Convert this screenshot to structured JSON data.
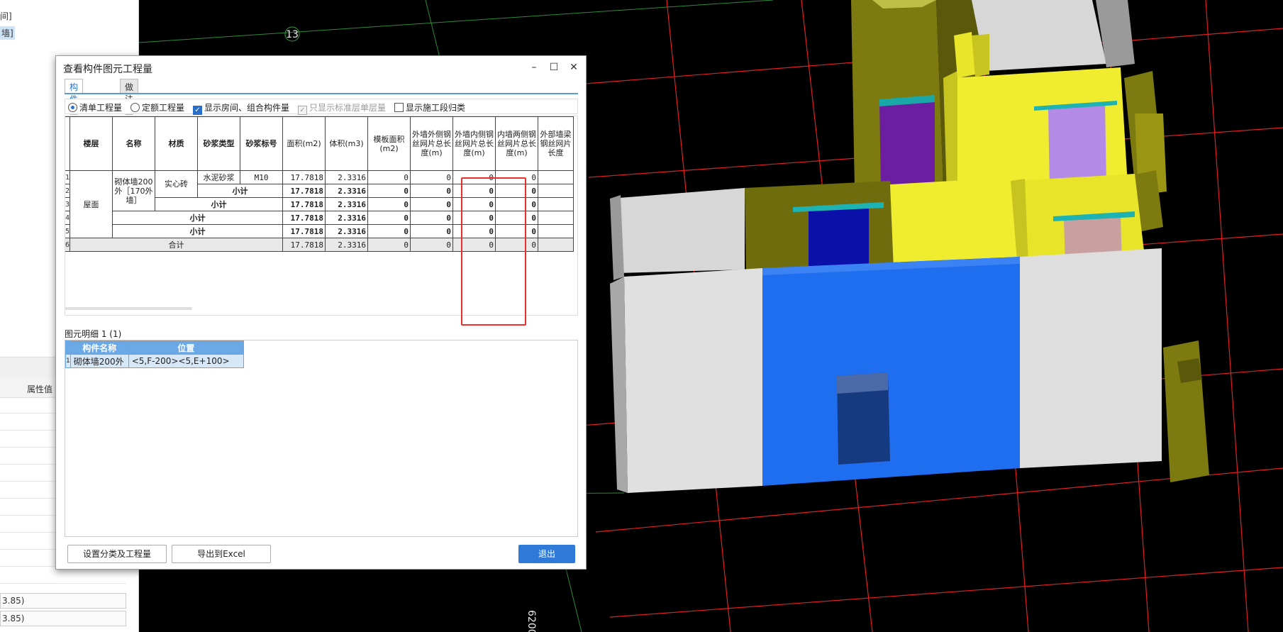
{
  "left_panel": {
    "tree_line_1": "间]",
    "tree_line_2": "墙]",
    "prop_header": "属性值",
    "bottom_values": [
      "3.85)",
      "3.85)"
    ]
  },
  "view3d": {
    "axis_label_top": "13",
    "axis_label_bottom": "6200"
  },
  "dialog": {
    "title": "查看构件图元工程量",
    "tabs": [
      "构件工程量",
      "做法工程量"
    ],
    "options": [
      {
        "label": "清单工程量",
        "type": "radio",
        "checked": true
      },
      {
        "label": "定额工程量",
        "type": "radio",
        "checked": false
      },
      {
        "label": "显示房间、组合构件量",
        "type": "checkbox",
        "checked": true
      },
      {
        "label": "只显示标准层单层量",
        "type": "checkbox",
        "checked": true,
        "disabled": true
      },
      {
        "label": "显示施工段归类",
        "type": "checkbox",
        "checked": false
      }
    ],
    "table": {
      "headers": [
        "楼层",
        "名称",
        "材质",
        "砂浆类型",
        "砂浆标号",
        "面积(m2)",
        "体积(m3)",
        "模板面积(m2)",
        "外墙外侧钢丝网片总长度(m)",
        "外墙内侧钢丝网片总长度(m)",
        "内墙两侧钢丝网片总长度(m)",
        "外部墙梁钢丝网片长度"
      ],
      "row_numbers": [
        "1",
        "2",
        "3",
        "4",
        "5",
        "6"
      ],
      "floor": "屋面",
      "name": "砌体墙200外［170外墙］",
      "material": "实心砖",
      "mortar_type": "水泥砂浆",
      "mortar_grade": "M10",
      "subtotal": "小计",
      "total": "合计",
      "area": "17.7818",
      "volume": "2.3316",
      "zero": "0"
    },
    "detail": {
      "title": "图元明细  1 (1)",
      "headers": [
        "构件名称",
        "位置"
      ],
      "row_number": "1",
      "component": "砌体墙200外",
      "position": "<5,F-200><5,E+100>"
    },
    "buttons": {
      "settings": "设置分类及工程量",
      "export": "导出到Excel",
      "exit": "退出"
    }
  }
}
